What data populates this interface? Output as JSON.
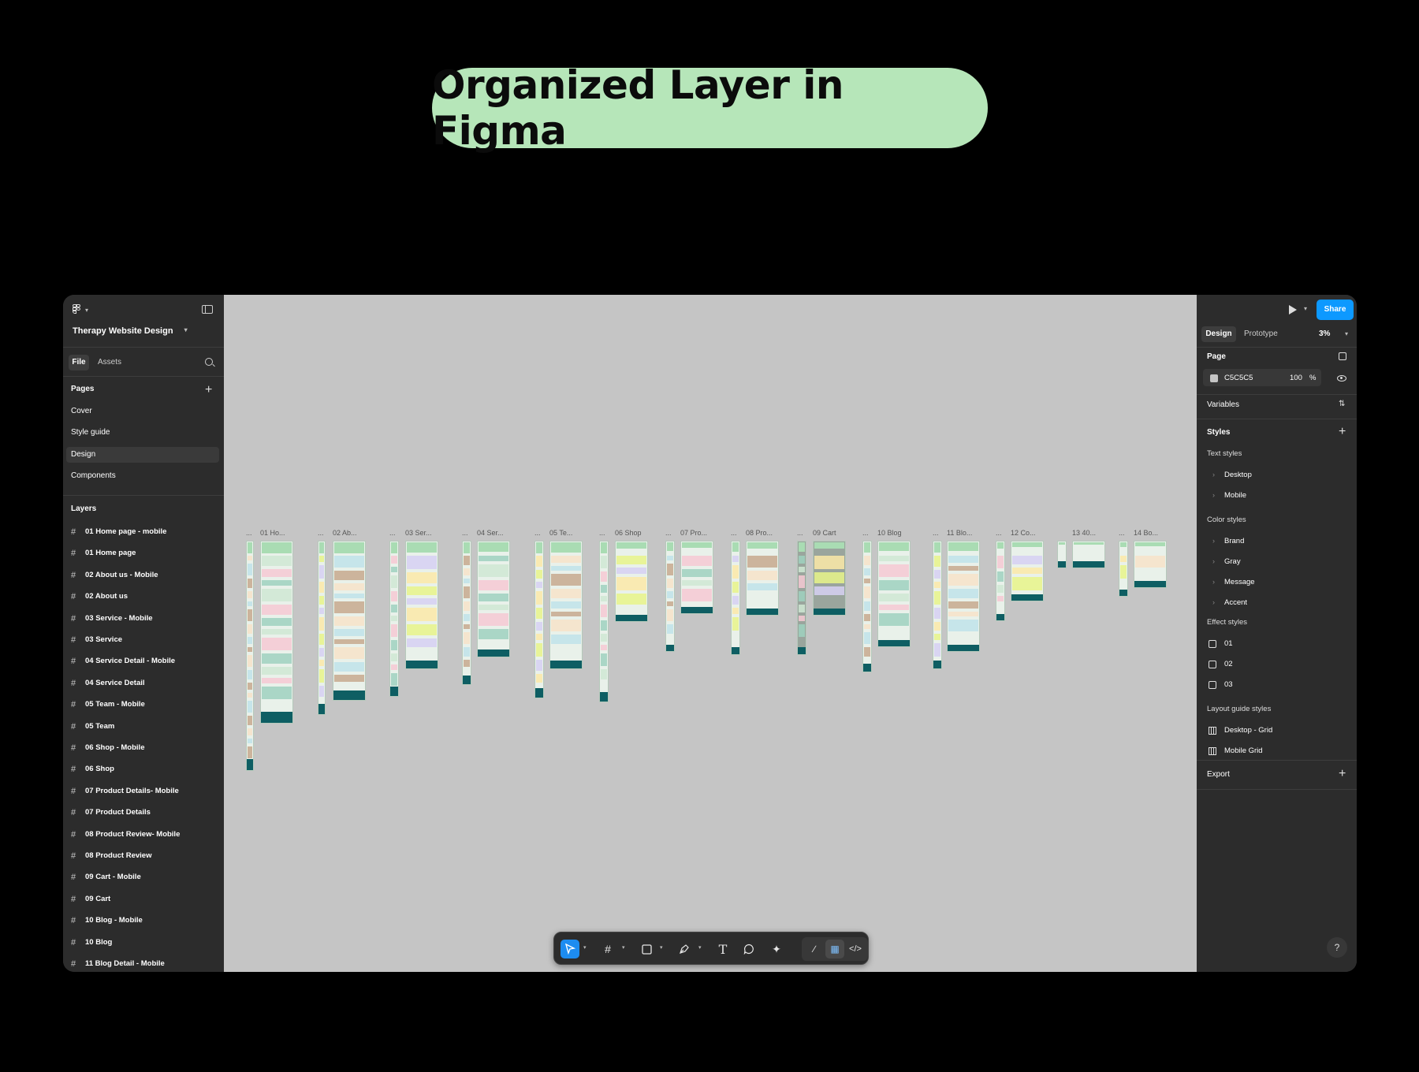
{
  "headline": "Organized Layer in Figma",
  "left": {
    "file_name": "Therapy Website Design",
    "tabs": {
      "file": "File",
      "assets": "Assets"
    },
    "pages_title": "Pages",
    "pages": [
      "Cover",
      "Style guide",
      "Design",
      "Components"
    ],
    "active_page": "Design",
    "layers_title": "Layers",
    "layers": [
      "01 Home page - mobile",
      "01 Home page",
      "02 About us - Mobile",
      "02 About us",
      "03 Service - Mobile",
      "03 Service",
      "04 Service Detail - Mobile",
      "04 Service Detail",
      "05 Team - Mobile",
      "05 Team",
      "06 Shop - Mobile",
      "06 Shop",
      "07 Product Details- Mobile",
      "07 Product Details",
      "08 Product Review- Mobile",
      "08 Product Review",
      "09 Cart - Mobile",
      "09 Cart",
      "10 Blog - Mobile",
      "10 Blog",
      "11 Blog Detail - Mobile"
    ]
  },
  "canvas": {
    "background": "#C5C5C5",
    "frame_labels": [
      "...",
      "01 Ho...",
      "...",
      "02 Ab...",
      "...",
      "03 Ser...",
      "...",
      "04 Ser...",
      "...",
      "05 Te...",
      "...",
      "06 Shop",
      "...",
      "07 Pro...",
      "...",
      "08 Pro...",
      "...",
      "09 Cart",
      "...",
      "10 Blog",
      "...",
      "11 Blo...",
      "...",
      "12 Co...",
      "13 40...",
      "...",
      "14 Bo..."
    ]
  },
  "toolbar": {
    "tools": [
      "move-icon",
      "frame-icon",
      "rectangle-icon",
      "pen-icon",
      "text-icon",
      "comment-icon",
      "actions-icon",
      "draw-mode-icon",
      "design-mode-icon",
      "dev-mode-icon"
    ]
  },
  "right": {
    "share": "Share",
    "tabs": {
      "design": "Design",
      "prototype": "Prototype"
    },
    "zoom": "3%",
    "page_title": "Page",
    "page_fill": {
      "hex": "C5C5C5",
      "opacity": "100",
      "unit": "%"
    },
    "variables": "Variables",
    "styles": "Styles",
    "text_styles_title": "Text styles",
    "text_styles": [
      "Desktop",
      "Mobile"
    ],
    "color_styles_title": "Color styles",
    "color_styles": [
      "Brand",
      "Gray",
      "Message",
      "Accent"
    ],
    "effect_styles_title": "Effect styles",
    "effect_styles": [
      "01",
      "02",
      "03"
    ],
    "layout_styles_title": "Layout guide styles",
    "layout_styles": [
      "Desktop - Grid",
      "Mobile Grid"
    ],
    "export": "Export",
    "help": "?"
  },
  "colors": {
    "accent": "#0D99FF",
    "pill": "#B6E6B9",
    "footer_teal": "#0E5E63"
  }
}
